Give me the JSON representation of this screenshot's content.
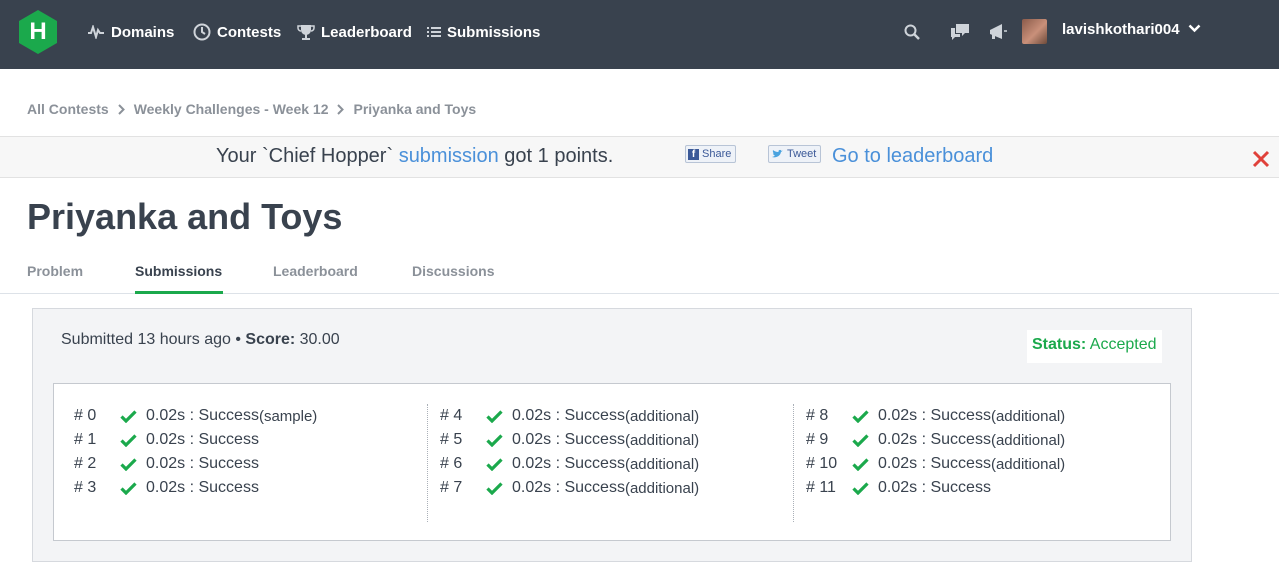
{
  "nav": {
    "logo_letter": "H",
    "items": [
      "Domains",
      "Contests",
      "Leaderboard",
      "Submissions"
    ],
    "username": "lavishkothari004"
  },
  "breadcrumb": [
    "All Contests",
    "Weekly Challenges - Week 12",
    "Priyanka and Toys"
  ],
  "notification": {
    "prefix": "Your `Chief Hopper` ",
    "link": "submission",
    "suffix": " got 1 points.",
    "share_label": "Share",
    "tweet_label": "Tweet",
    "leaderboard_link": "Go to leaderboard"
  },
  "page_title": "Priyanka and Toys",
  "tabs": [
    "Problem",
    "Submissions",
    "Leaderboard",
    "Discussions"
  ],
  "submission": {
    "submitted_text": "Submitted 13 hours ago",
    "bullet": " • ",
    "score_label": "Score:",
    "score_value": " 30.00",
    "status_label": "Status:",
    "status_value": " Accepted"
  },
  "test_cases": [
    {
      "num": "# 0",
      "time": "0.02s : Success",
      "note": " (sample)"
    },
    {
      "num": "# 1",
      "time": "0.02s : Success",
      "note": ""
    },
    {
      "num": "# 2",
      "time": "0.02s : Success",
      "note": ""
    },
    {
      "num": "# 3",
      "time": "0.02s : Success",
      "note": ""
    },
    {
      "num": "# 4",
      "time": "0.02s : Success",
      "note": " (additional)"
    },
    {
      "num": "# 5",
      "time": "0.02s : Success",
      "note": " (additional)"
    },
    {
      "num": "# 6",
      "time": "0.02s : Success",
      "note": " (additional)"
    },
    {
      "num": "# 7",
      "time": "0.02s : Success",
      "note": " (additional)"
    },
    {
      "num": "# 8",
      "time": "0.02s : Success",
      "note": " (additional)"
    },
    {
      "num": "# 9",
      "time": "0.02s : Success",
      "note": " (additional)"
    },
    {
      "num": "# 10",
      "time": "0.02s : Success",
      "note": " (additional)"
    },
    {
      "num": "# 11",
      "time": "0.02s : Success",
      "note": ""
    }
  ],
  "colors": {
    "nav_bg": "#39424e",
    "logo": "#1ba94c",
    "accent_green": "#1ba94c",
    "link_blue": "#4a90d9",
    "close_red": "#e0413a"
  },
  "icons": [
    "domains-icon",
    "contests-icon",
    "trophy-icon",
    "list-icon",
    "search-icon",
    "chat-icon",
    "megaphone-icon",
    "chevron-down-icon",
    "check-icon",
    "close-icon"
  ]
}
